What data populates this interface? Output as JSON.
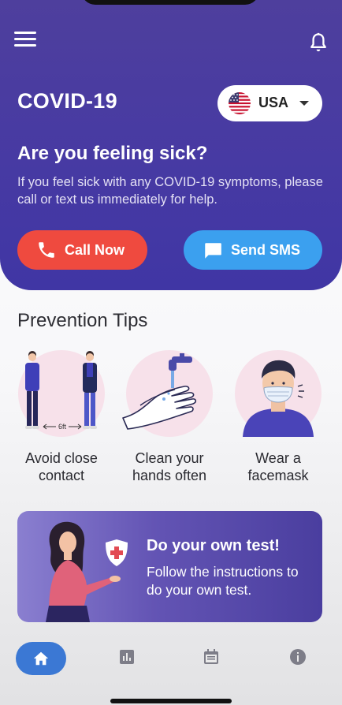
{
  "header": {
    "title": "COVID-19",
    "country": {
      "label": "USA",
      "flag_icon": "us-flag-icon"
    },
    "question": "Are you feeling sick?",
    "subtext": "If you feel sick with any COVID-19 symptoms, please call or text us immediately for help.",
    "call_button": "Call Now",
    "sms_button": "Send SMS"
  },
  "prevention": {
    "title": "Prevention Tips",
    "tips": [
      {
        "label": "Avoid close contact",
        "line1": "Avoid close",
        "line2": "contact",
        "distance_label": "6ft",
        "icon": "social-distance-illustration"
      },
      {
        "label": "Clean your hands often",
        "line1": "Clean your",
        "line2": "hands often",
        "icon": "hand-wash-illustration"
      },
      {
        "label": "Wear a facemask",
        "line1": "Wear a",
        "line2": "facemask",
        "icon": "facemask-illustration"
      }
    ]
  },
  "self_test": {
    "title": "Do your own test!",
    "text": "Follow the instructions to do your own test."
  },
  "bottom_nav": {
    "items": [
      {
        "icon": "home-icon",
        "active": true
      },
      {
        "icon": "bar-chart-icon",
        "active": false
      },
      {
        "icon": "calendar-icon",
        "active": false
      },
      {
        "icon": "info-icon",
        "active": false
      }
    ]
  },
  "colors": {
    "header": "#473aa3",
    "call": "#ef4a3f",
    "sms": "#3ba0ef",
    "nav_active": "#3b78d4",
    "tip_circle": "#f7e1ea"
  }
}
